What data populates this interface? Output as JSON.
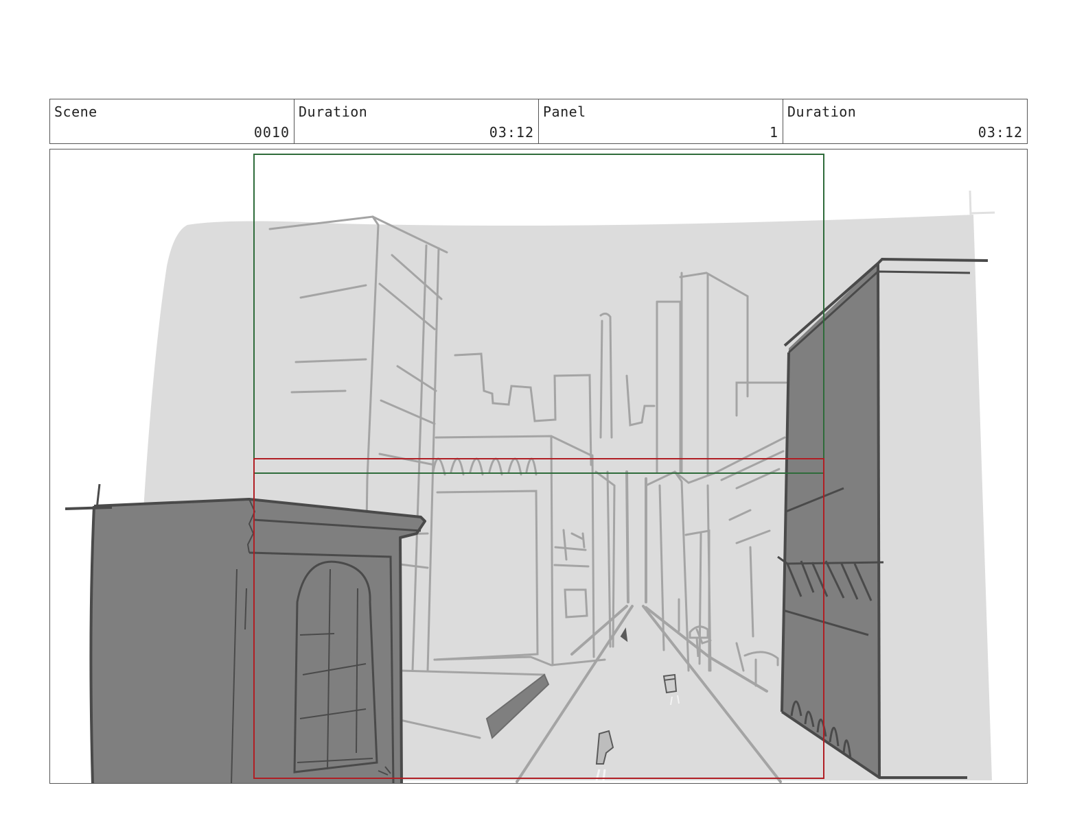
{
  "header": {
    "scene_label": "Scene",
    "scene_value": "0010",
    "scene_duration_label": "Duration",
    "scene_duration_value": "03:12",
    "panel_label": "Panel",
    "panel_value": "1",
    "panel_duration_label": "Duration",
    "panel_duration_value": "03:12"
  },
  "colors": {
    "sky": "#dcdcdc",
    "building_dark": "#7f7f7f",
    "line_light": "#a4a4a4",
    "line_dark": "#4a4a4a",
    "frame_green": "#2e6b3a",
    "frame_red": "#b01e24"
  }
}
